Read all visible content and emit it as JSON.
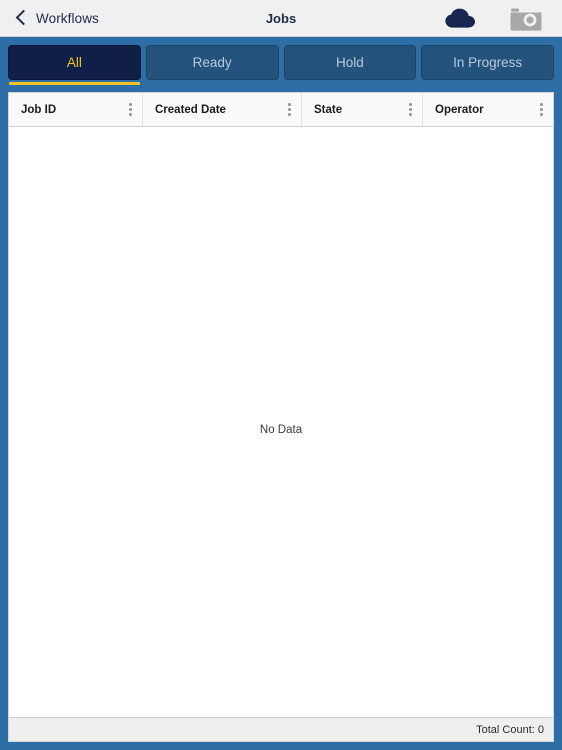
{
  "navbar": {
    "back_label": "Workflows",
    "title": "Jobs",
    "back_icon": "chevron-left-icon",
    "cloud_icon": "cloud-icon",
    "camera_icon": "camera-icon",
    "colors": {
      "background": "#f0f0f0",
      "text": "#1f2a4d",
      "cloud": "#17254f",
      "camera": "#a8a8a8"
    }
  },
  "tabs": {
    "items": [
      {
        "label": "All",
        "active": true
      },
      {
        "label": "Ready",
        "active": false
      },
      {
        "label": "Hold",
        "active": false
      },
      {
        "label": "In Progress",
        "active": false
      }
    ],
    "colors": {
      "bar_background": "#2e6ea6",
      "inactive_background": "#23527c",
      "inactive_text": "#b9c9da",
      "active_background": "#0f1f47",
      "active_text": "#f2c327",
      "active_underline": "#f2c327"
    }
  },
  "table": {
    "columns": [
      {
        "label": "Job ID",
        "menu_icon": "kebab-menu-icon"
      },
      {
        "label": "Created Date",
        "menu_icon": "kebab-menu-icon"
      },
      {
        "label": "State",
        "menu_icon": "kebab-menu-icon"
      },
      {
        "label": "Operator",
        "menu_icon": "kebab-menu-icon"
      }
    ],
    "rows": [],
    "empty_message": "No Data",
    "footer": {
      "total_count_label": "Total Count: 0"
    }
  }
}
